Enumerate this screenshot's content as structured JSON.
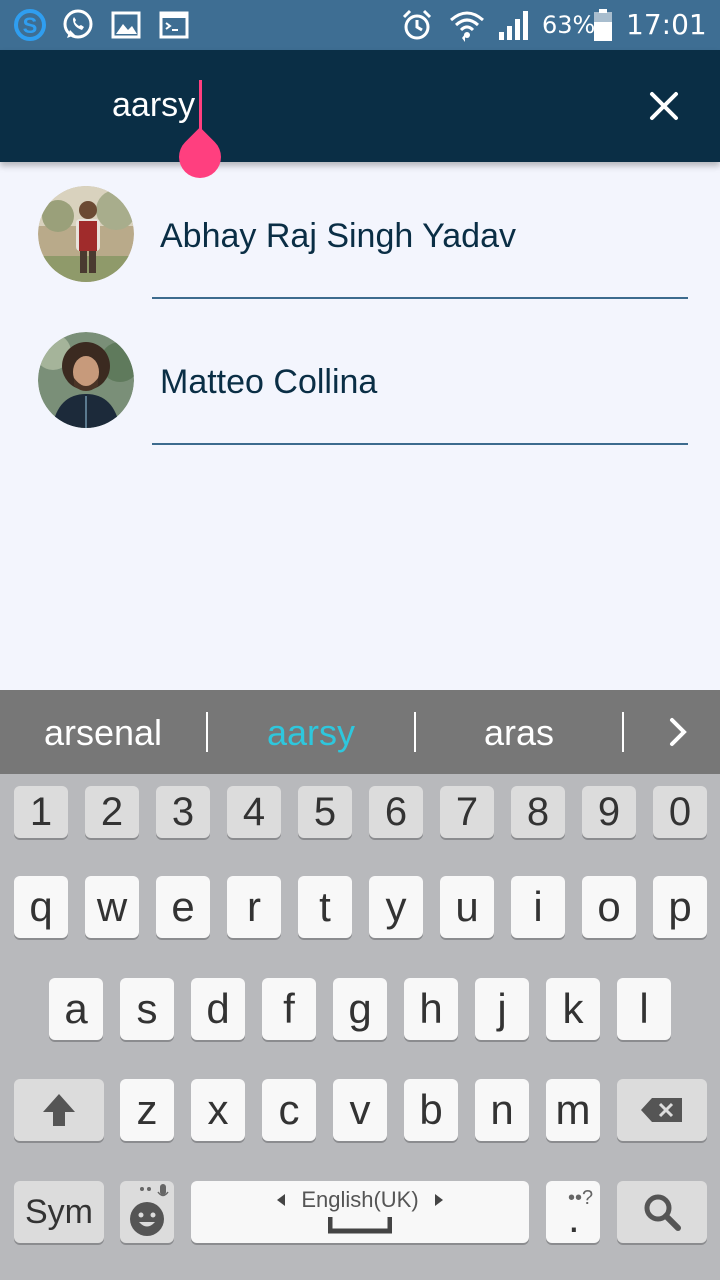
{
  "status_bar": {
    "battery_percent": "63%",
    "time": "17:01",
    "left_icons": [
      "skype-icon",
      "whatsapp-icon",
      "gallery-icon",
      "terminal-icon"
    ],
    "right_icons": [
      "alarm-icon",
      "wifi-icon",
      "signal-icon",
      "battery-icon"
    ]
  },
  "search": {
    "query": "aarsy",
    "clear_icon": "close-icon"
  },
  "results": [
    {
      "name": "Abhay Raj Singh Yadav"
    },
    {
      "name": "Matteo Collina"
    }
  ],
  "keyboard": {
    "suggestions": [
      "arsenal",
      "aarsy",
      "aras"
    ],
    "selected_suggestion": "aarsy",
    "number_row": [
      "1",
      "2",
      "3",
      "4",
      "5",
      "6",
      "7",
      "8",
      "9",
      "0"
    ],
    "row1": [
      "q",
      "w",
      "e",
      "r",
      "t",
      "y",
      "u",
      "i",
      "o",
      "p"
    ],
    "row2": [
      "a",
      "s",
      "d",
      "f",
      "g",
      "h",
      "j",
      "k",
      "l"
    ],
    "row3": [
      "z",
      "x",
      "c",
      "v",
      "b",
      "n",
      "m"
    ],
    "sym_label": "Sym",
    "space_label": "English(UK)",
    "period_label": ".",
    "accent_color": "#2ec7dd",
    "cursor_color": "#ff3f7f"
  }
}
